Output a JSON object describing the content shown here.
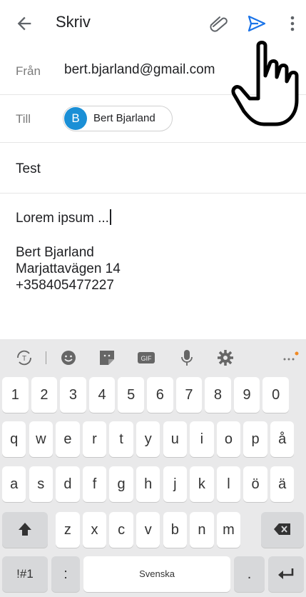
{
  "appbar": {
    "title": "Skriv"
  },
  "from": {
    "label": "Från",
    "value": "bert.bjarland@gmail.com"
  },
  "to": {
    "label": "Till",
    "recipient_initial": "B",
    "recipient_name": "Bert Bjarland"
  },
  "subject": {
    "value": "Test"
  },
  "body": {
    "text": "Lorem ipsum ...",
    "signature": [
      "Bert Bjarland",
      "Marjattavägen 14",
      "+358405477227"
    ]
  },
  "keyboard": {
    "rows": [
      [
        "1",
        "2",
        "3",
        "4",
        "5",
        "6",
        "7",
        "8",
        "9",
        "0"
      ],
      [
        "q",
        "w",
        "e",
        "r",
        "t",
        "y",
        "u",
        "i",
        "o",
        "p",
        "å"
      ],
      [
        "a",
        "s",
        "d",
        "f",
        "g",
        "h",
        "j",
        "k",
        "l",
        "ö",
        "ä"
      ],
      [
        "z",
        "x",
        "c",
        "v",
        "b",
        "n",
        "m"
      ]
    ],
    "sym_label": "!#1",
    "colon_label": ":",
    "space_label": "Svenska",
    "period_label": ".",
    "gif_label": "GIF"
  },
  "colors": {
    "accent": "#1a73e8",
    "avatar": "#1a8fd6",
    "keyboard_bg": "#e9e9ea"
  },
  "icons": [
    "back-arrow-icon",
    "paperclip-icon",
    "send-icon",
    "more-vert-icon",
    "hand-cursor-icon",
    "translate-icon",
    "emoji-icon",
    "sticker-icon",
    "gif-icon",
    "mic-icon",
    "settings-icon",
    "more-horiz-icon",
    "shift-icon",
    "backspace-icon",
    "enter-icon"
  ]
}
